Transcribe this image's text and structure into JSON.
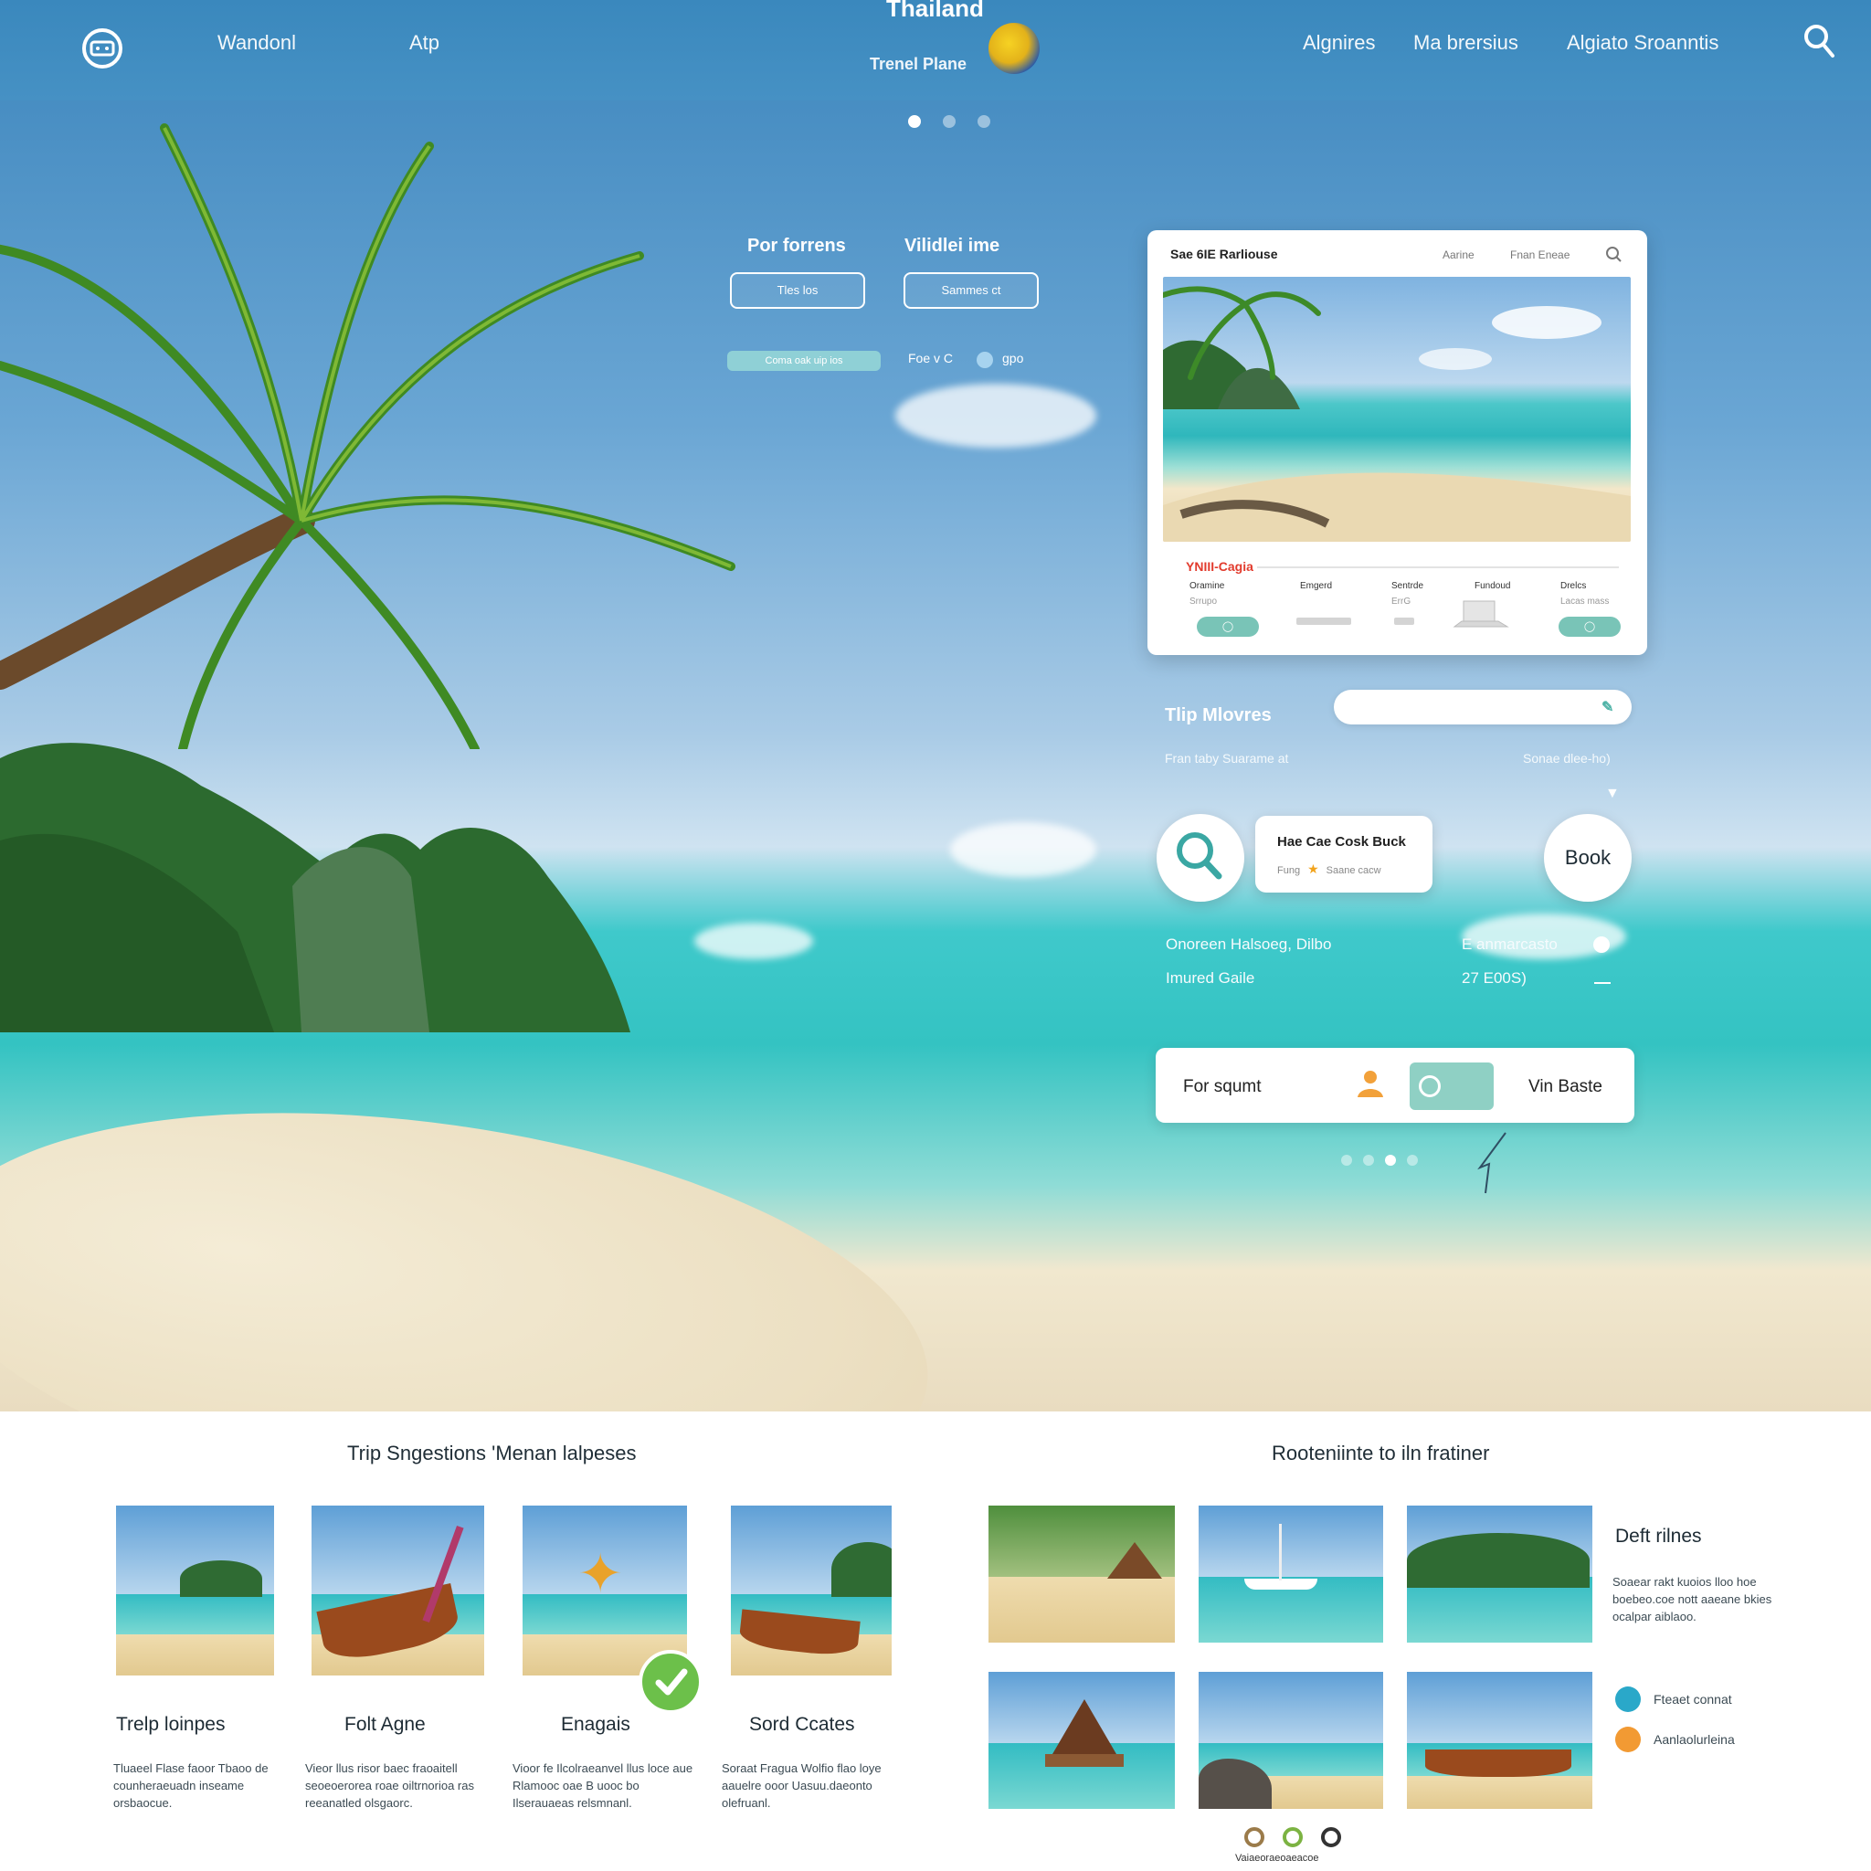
{
  "header": {
    "nav_left": [
      "Wandonl",
      "Atp"
    ],
    "brand_title": "Thailand",
    "brand_subtitle": "Trenel Plane",
    "nav_right": [
      "Algnires",
      "Ma brersius",
      "Algiato Sroanntis"
    ]
  },
  "hero": {
    "carousel_dots": 3,
    "carousel_active": 1,
    "filter_labels": [
      "Por forrens",
      "Vilidlei ime"
    ],
    "filter_buttons": [
      "Tles los",
      "Sammes ct"
    ],
    "pill_bar_text": "Coma oak uip ios",
    "toggle_left": "Foe v C",
    "toggle_right": "gpo"
  },
  "preview_card": {
    "title": "Sae 6IE Rarliouse",
    "links": [
      "Aarine",
      "Fnan Eneae"
    ],
    "tag": "YNIII-Cagia",
    "columns": [
      {
        "label": "Oramine",
        "sub": "Srrupo"
      },
      {
        "label": "Emgerd",
        "sub": ""
      },
      {
        "label": "Sentrde",
        "sub": "ErrG"
      },
      {
        "label": "Fundoud",
        "sub": ""
      },
      {
        "label": "Drelcs",
        "sub": "Lacas mass"
      }
    ]
  },
  "trip": {
    "title": "Tlip Mlovres",
    "left_caption": "Fran taby Suarame at",
    "right_caption": "Sonae dlee-ho)",
    "mini_card_title": "Hae Cae Cosk Buck",
    "mini_card_left": "Fung",
    "mini_card_right": "Saane cacw",
    "book_label": "Book",
    "row1_left": "Onoreen Halsoeg, Dilbo",
    "row1_right": "E anmarcasto",
    "row2_left": "Imured Gaile",
    "row2_right": "27 E00S)",
    "action_left": "For squmt",
    "action_right": "Vin Baste",
    "pager_dots": 4,
    "pager_active": 2
  },
  "suggestions": {
    "title": "Trip Sngestions 'Menan lalpeses",
    "cards": [
      {
        "title": "Trelp loinpes",
        "desc": "Tluaeel Flase faoor Tbaoo de counheraeuadn inseame orsbaocue."
      },
      {
        "title": "Folt Agne",
        "desc": "Vieor llus risor baec fraoaitell seoeoerorea roae oiltrnorioa ras reeanatled olsgaorc."
      },
      {
        "title": "Enagais",
        "desc": "Vioor fe Ilcolraeanvel llus loce aue Rlamooc oae B uooc bo Ilserauaeas relsmnanl."
      },
      {
        "title": "Sord Ccates",
        "desc": "Soraat Fragua Wolfio flao loye aauelre ooor Uasuu.daeonto olefruanl."
      }
    ]
  },
  "recommend": {
    "title": "Rooteniinte to iln fratiner",
    "side_title": "Deft rilnes",
    "side_desc": "Soaear rakt kuoios lloo hoe boebeo.coe nott aaeane bkies ocalpar aiblaoo.",
    "options": [
      "Fteaet connat",
      "Aanlaolurleina"
    ],
    "footer_text": "Vaiaeoraeoaeacoe"
  },
  "colors": {
    "nav_bg": "#3a88bd",
    "accent_teal": "#79c4b7",
    "check_green": "#6cc04a",
    "option_blue": "#2aa8c9",
    "option_orange": "#f29a33"
  }
}
